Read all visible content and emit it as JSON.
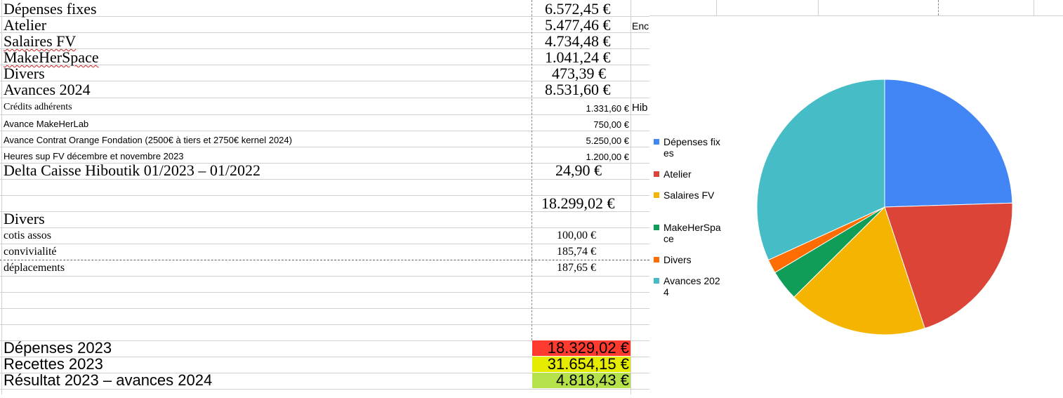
{
  "rows": [
    {
      "label": "Dépenses fixes",
      "value": "6.572,45 €"
    },
    {
      "label": "Atelier",
      "value": "5.477,46 €"
    },
    {
      "label": "Salaires FV",
      "value": "4.734,48 €"
    },
    {
      "label": "MakeHerSpace",
      "value": "1.041,24 €"
    },
    {
      "label": "Divers",
      "value": "473,39 €"
    },
    {
      "label": "Avances 2024",
      "value": "8.531,60 €"
    },
    {
      "label": "Crédits adhérents",
      "value": "1.331,60 €"
    },
    {
      "label": "Avance MakeHerLab",
      "value": "750,00 €"
    },
    {
      "label": "Avance Contrat Orange Fondation (2500€ à tiers et 2750€ kernel 2024)",
      "value": "5.250,00 €"
    },
    {
      "label": "Heures sup FV décembre et novembre 2023",
      "value": "1.200,00 €"
    },
    {
      "label": "Delta Caisse Hiboutik 01/2023 – 01/2022",
      "value": "24,90 €"
    },
    {
      "label": "",
      "value": ""
    },
    {
      "label": "",
      "value": "18.299,02 €"
    },
    {
      "label": "Divers",
      "value": ""
    },
    {
      "label": "cotis assos",
      "value": "100,00 €"
    },
    {
      "label": "convivialité",
      "value": "185,74 €"
    },
    {
      "label": "déplacements",
      "value": "187,65 €"
    }
  ],
  "side_notes": {
    "row2": "Enc",
    "row7": "Hib"
  },
  "summary": [
    {
      "label": "Dépenses 2023",
      "value": "18.329,02 €",
      "color": "#ff3b30"
    },
    {
      "label": "Recettes 2023",
      "value": "31.654,15 €",
      "color": "#e6ec00"
    },
    {
      "label": "Résultat 2023 – avances 2024",
      "value": "4.818,43 €",
      "color": "#b5e24a"
    }
  ],
  "chart_data": {
    "type": "pie",
    "title": "",
    "categories": [
      "Dépenses fixes",
      "Atelier",
      "Salaires FV",
      "MakeHerSpace",
      "Divers",
      "Avances 2024"
    ],
    "values": [
      6572.45,
      5477.46,
      4734.48,
      1041.24,
      473.39,
      8531.6
    ],
    "colors": [
      "#4285f4",
      "#db4437",
      "#f4b400",
      "#0f9d58",
      "#ff6d01",
      "#46bdc6"
    ],
    "legend_position": "left",
    "legend_labels": [
      "Dépenses fixes",
      "Atelier",
      "Salaires FV",
      "MakeHerSpace",
      "Divers",
      "Avances 2024"
    ]
  }
}
